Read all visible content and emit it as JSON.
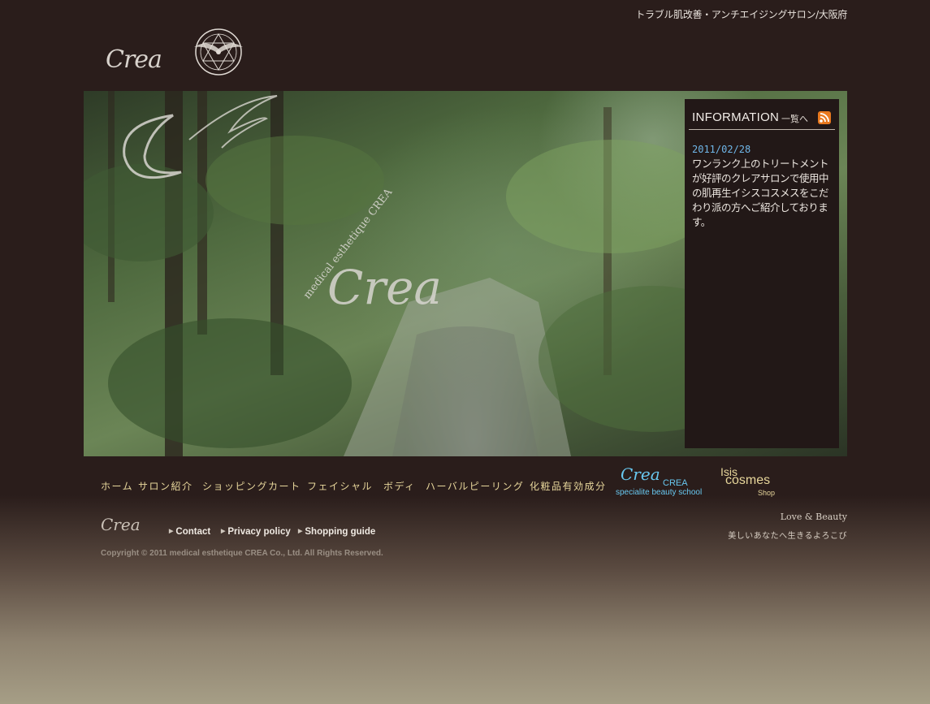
{
  "header": {
    "tagline": "トラブル肌改善・アンチエイジングサロン/大阪府",
    "logo_text": "Crea",
    "logo_small_text": "medical esthetique CREA"
  },
  "hero": {
    "logo_main": "Crea",
    "logo_sub": "medical esthetique CREA"
  },
  "info": {
    "title": "INFORMATION",
    "list_link": "一覧へ",
    "date": "2011/02/28",
    "body": "ワンランク上のトリートメントが好評のクレアサロンで使用中の肌再生イシスコスメスをこだわり派の方へご紹介しております。"
  },
  "nav": {
    "items": [
      "ホーム",
      "サロン紹介",
      "ショッピングカート",
      "フェイシャル",
      "ボディ",
      "ハーバルピーリング",
      "化粧品有効成分"
    ]
  },
  "school": {
    "logo": "Crea",
    "name": "CREA",
    "sub": "specialite beauty school"
  },
  "isis": {
    "line1": "Isis",
    "line2": "cosmes",
    "line3": "Shop"
  },
  "footer": {
    "logo_text": "Crea",
    "links": [
      "Contact",
      "Privacy policy",
      "Shopping guide"
    ],
    "love": "Love & Beauty",
    "love_sub": "美しいあなたへ生きるよろこび",
    "copyright": "Copyright © 2011 medical esthetique CREA Co., Ltd. All Rights Reserved."
  },
  "colors": {
    "background": "#2a1d1b",
    "nav_text": "#e7d69b",
    "date_accent": "#6fb6e8",
    "school_accent": "#68c8f0",
    "rss": "#e8791f"
  }
}
